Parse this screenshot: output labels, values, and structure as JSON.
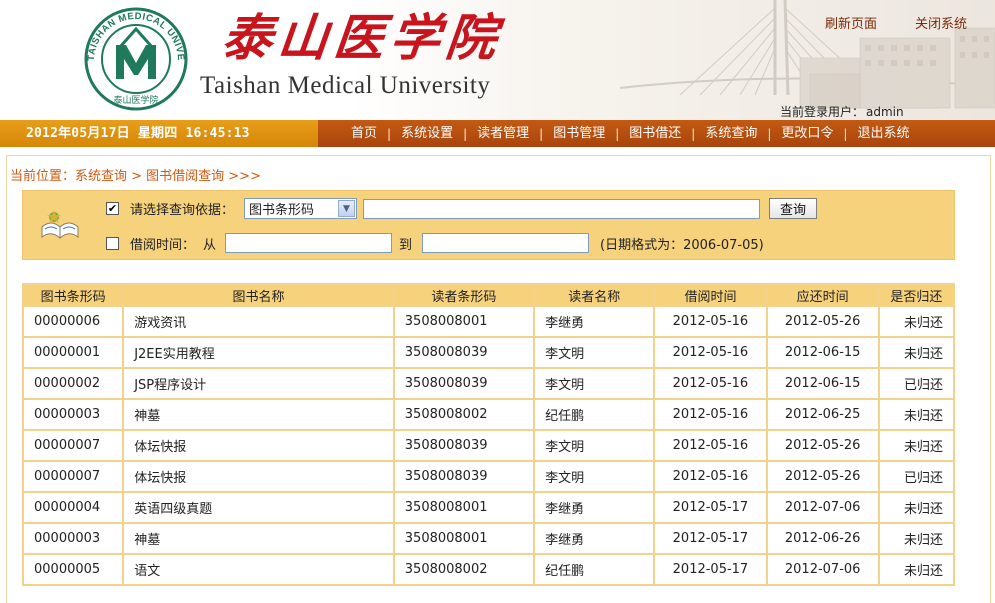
{
  "header": {
    "logo_cn": "泰山医学院",
    "logo_en": "Taishan Medical University",
    "seal_text": "TAISHAN MEDICAL UNIVERSITY",
    "seal_cn": "泰山医学院",
    "links": {
      "refresh": "刷新页面",
      "close": "关闭系统"
    },
    "current_user_label": "当前登录用户：",
    "current_user": "admin"
  },
  "nav": {
    "date": "2012年05月17日 星期四 16:45:13",
    "items": [
      "首页",
      "系统设置",
      "读者管理",
      "图书管理",
      "图书借还",
      "系统查询",
      "更改口令",
      "退出系统"
    ],
    "separator": "|"
  },
  "breadcrumb": "当前位置：系统查询 > 图书借阅查询 >>>",
  "query": {
    "row1": {
      "checked": true,
      "check_mark": "✔",
      "label": "请选择查询依据：",
      "select_value": "图书条形码",
      "input_value": "",
      "button": "查询"
    },
    "row2": {
      "checked": false,
      "label": "借阅时间：",
      "from": "从",
      "to": "到",
      "from_value": "",
      "to_value": "",
      "hint": "(日期格式为：2006-07-05)"
    }
  },
  "table": {
    "headers": [
      "图书条形码",
      "图书名称",
      "读者条形码",
      "读者名称",
      "借阅时间",
      "应还时间",
      "是否归还"
    ],
    "rows": [
      [
        "00000006",
        "游戏资讯",
        "3508008001",
        "李继勇",
        "2012-05-16",
        "2012-05-26",
        "未归还"
      ],
      [
        "00000001",
        "J2EE实用教程",
        "3508008039",
        "李文明",
        "2012-05-16",
        "2012-06-15",
        "未归还"
      ],
      [
        "00000002",
        "JSP程序设计",
        "3508008039",
        "李文明",
        "2012-05-16",
        "2012-06-15",
        "已归还"
      ],
      [
        "00000003",
        "神墓",
        "3508008002",
        "纪任鹏",
        "2012-05-16",
        "2012-06-25",
        "未归还"
      ],
      [
        "00000007",
        "体坛快报",
        "3508008039",
        "李文明",
        "2012-05-16",
        "2012-05-26",
        "未归还"
      ],
      [
        "00000007",
        "体坛快报",
        "3508008039",
        "李文明",
        "2012-05-16",
        "2012-05-26",
        "已归还"
      ],
      [
        "00000004",
        "英语四级真题",
        "3508008001",
        "李继勇",
        "2012-05-17",
        "2012-07-06",
        "未归还"
      ],
      [
        "00000003",
        "神墓",
        "3508008001",
        "李继勇",
        "2012-05-17",
        "2012-06-26",
        "未归还"
      ],
      [
        "00000005",
        "语文",
        "3508008002",
        "纪任鹏",
        "2012-05-17",
        "2012-07-06",
        "未归还"
      ]
    ]
  },
  "colors": {
    "nav_bar": "#b24c0e",
    "date_bar": "#e09418",
    "panel": "#f7d27d",
    "title_red": "#c8141c",
    "logo_green": "#1f7a5c"
  },
  "icons": {
    "seal": "university-seal-icon",
    "book": "open-book-icon",
    "dropdown": "chevron-down-icon"
  }
}
